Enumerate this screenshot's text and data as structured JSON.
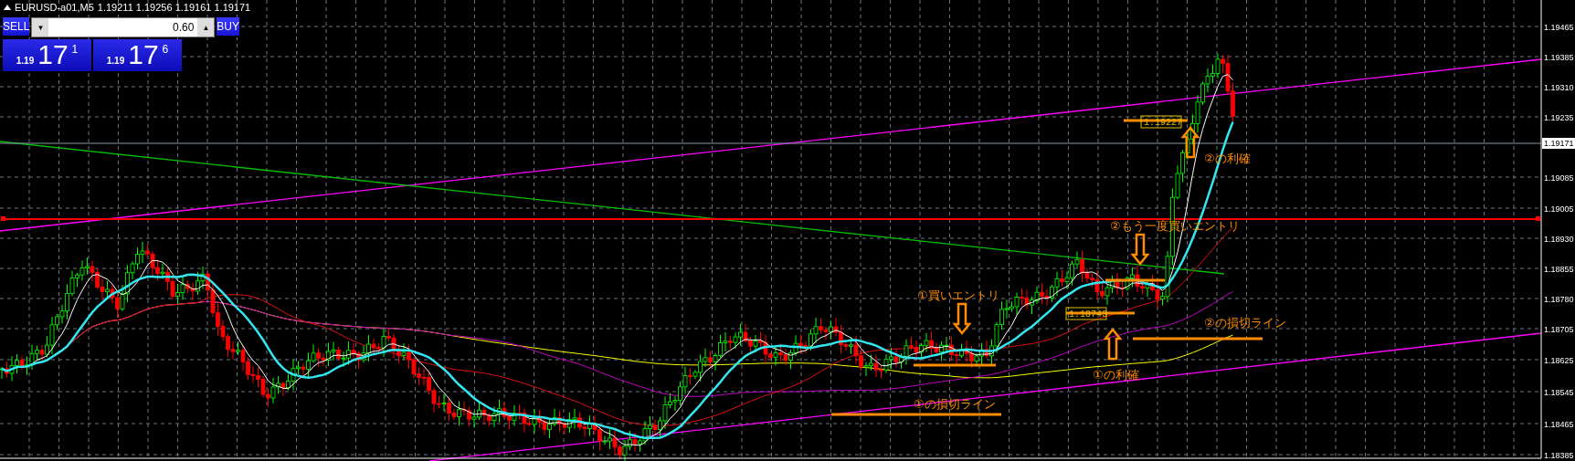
{
  "symbol_bar": {
    "title": "EURUSD-a01,M5",
    "ohlc": "1.19211 1.19256 1.19161 1.19171"
  },
  "trade_panel": {
    "sell_label": "SELL",
    "lots": "0.60",
    "buy_label": "BUY",
    "sell_price": {
      "prefix": "1.19",
      "main": "17",
      "super": "1"
    },
    "buy_price": {
      "prefix": "1.19",
      "main": "17",
      "super": "6"
    }
  },
  "price_axis": {
    "ticks": [
      "1.19465",
      "1.19385",
      "1.19310",
      "1.19235",
      "1.19085",
      "1.19005",
      "1.18930",
      "1.18855",
      "1.18780",
      "1.18705",
      "1.18625",
      "1.18545",
      "1.18465",
      "1.18385"
    ],
    "current": "1.19171"
  },
  "price_tags": [
    "1.19227",
    "1.18743"
  ],
  "annotations": [
    "②の利確",
    "②もう一度買いエントリ",
    "①買いエントリ",
    "②の損切ライン",
    "①の利確",
    "①の損切ライン"
  ],
  "spinner": {
    "down": "▼",
    "up": "▲"
  }
}
